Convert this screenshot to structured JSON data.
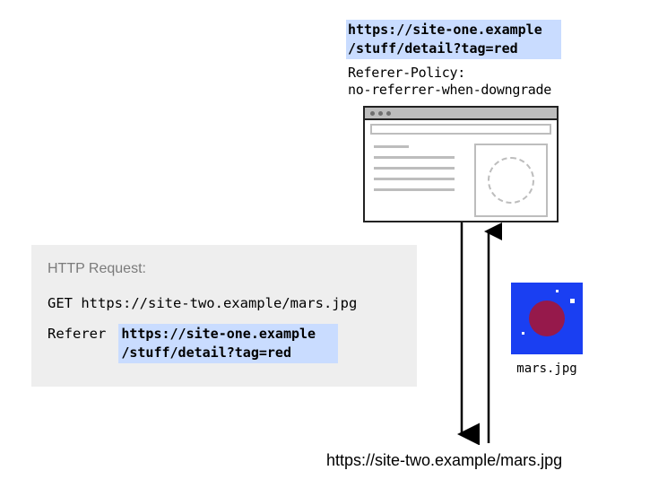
{
  "top": {
    "url": "https://site-one.example /stuff/detail?tag=red",
    "referer_policy_label": "Referer-Policy:",
    "referer_policy_value": "no-referrer-when-downgrade"
  },
  "http_request": {
    "title": "HTTP Request:",
    "method_line": "GET https://site-two.example/mars.jpg",
    "referer_label": "Referer",
    "referer_url": "https://site-one.example /stuff/detail?tag=red"
  },
  "mars": {
    "caption": "mars.jpg"
  },
  "bottom": {
    "url": "https://site-two.example/mars.jpg"
  }
}
